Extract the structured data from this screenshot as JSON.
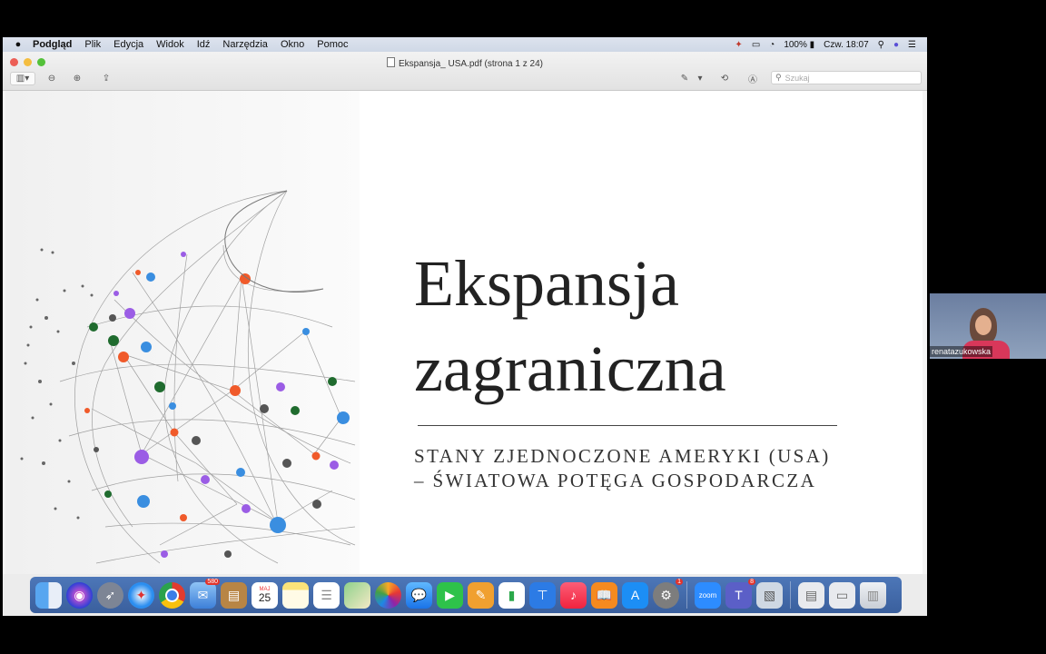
{
  "menubar": {
    "app_name": "Podgląd",
    "items": [
      "Plik",
      "Edycja",
      "Widok",
      "Idź",
      "Narzędzia",
      "Okno",
      "Pomoc"
    ],
    "battery": "100%",
    "clock": "Czw. 18:07"
  },
  "window": {
    "title": "Ekspansja_ USA.pdf (strona 1 z 24)",
    "search_placeholder": "Szukaj"
  },
  "slide": {
    "title_line1": "Ekspansja",
    "title_line2": "zagraniczna",
    "subtitle_line1": "STANY ZJEDNOCZONE AMERYKI (USA)",
    "subtitle_line2": "– ŚWIATOWA POTĘGA GOSPODARCZA"
  },
  "dock": {
    "calendar_day": "25",
    "calendar_month": "MAJ",
    "zoom_label": "zoom",
    "badges": {
      "mail": "580",
      "settings": "1",
      "teams": "8"
    }
  },
  "participant": {
    "name": "renatazukowska"
  },
  "colors": {
    "menubar": "#d5dde9",
    "dock": "#4469aa",
    "accent_orange": "#f05a2a",
    "accent_blue": "#3a8ee0",
    "accent_purple": "#9b5de5",
    "accent_green": "#1f6b2e"
  }
}
